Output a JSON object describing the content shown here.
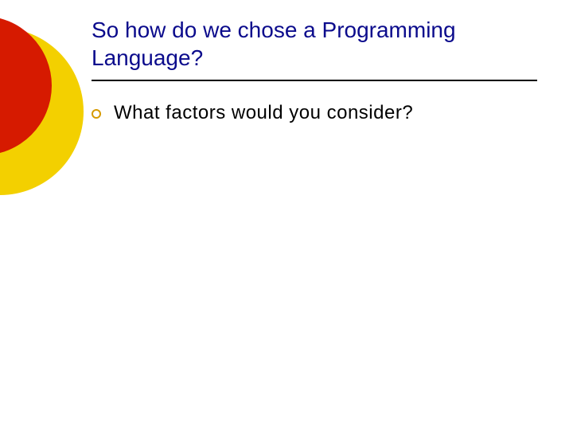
{
  "slide": {
    "title": "So how do we chose a Programming Language?",
    "bullets": [
      "What factors would you consider?"
    ]
  }
}
